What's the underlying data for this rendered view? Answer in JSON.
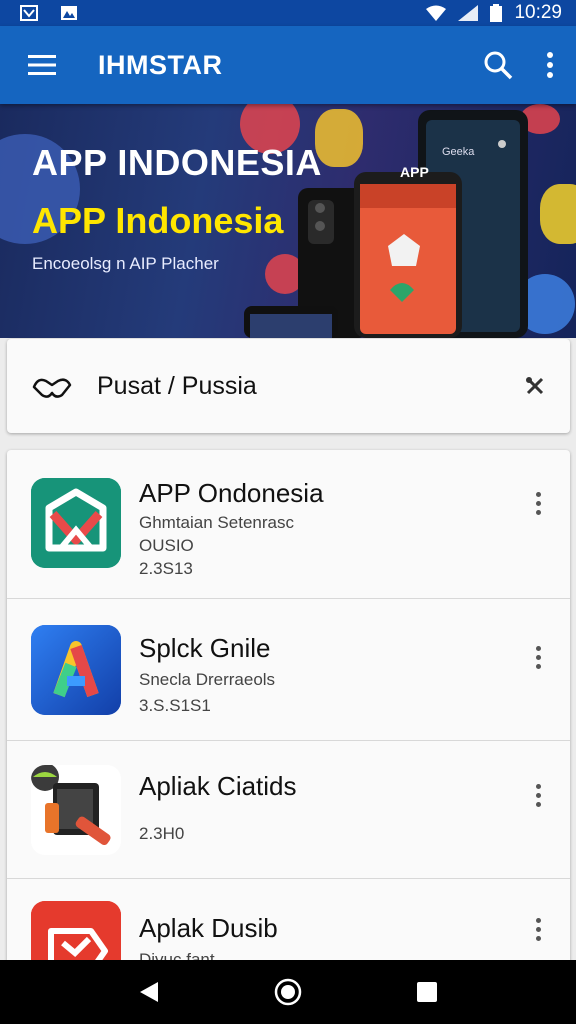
{
  "status_bar": {
    "time": "10:29"
  },
  "app_bar": {
    "title": "IHMSTAR"
  },
  "banner": {
    "title_line1": "APP INDONESIA",
    "title_line2": "APP Indonesia",
    "subtitle": "Encoeolsg n AIP Placher",
    "phone_label_small": "Geeka",
    "phone_label": "APP"
  },
  "category": {
    "label": "Pusat / Pussia"
  },
  "apps": [
    {
      "name": "APP Ondonesia",
      "line1": "Ghmtaian Setenrasc",
      "line2": "OUSIO",
      "line3": "2.3S13"
    },
    {
      "name": "Splck Gnile",
      "line1": "Snecla Drerraeols",
      "line2": "3.S.S1S1"
    },
    {
      "name": "Apliak Ciatids",
      "line1": "2.3H0"
    },
    {
      "name": "Aplak Dusib",
      "line1": "Divuc fant"
    }
  ],
  "colors": {
    "status_bar": "#0d47a1",
    "app_bar": "#1565c0",
    "banner_accent": "#ffe600",
    "nav_bar": "#000000"
  }
}
